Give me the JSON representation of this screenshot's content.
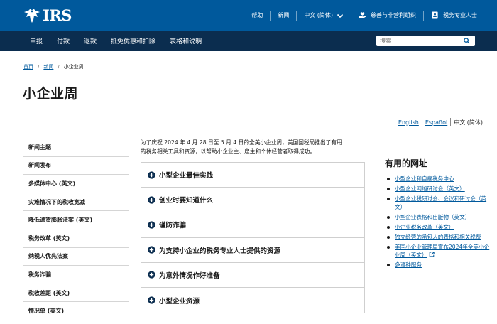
{
  "header": {
    "logo_text": "IRS",
    "links": {
      "help": "帮助",
      "news": "新闻",
      "language": "中文 (简体)",
      "charities": "慈善与非营利组织",
      "tax_pros": "税务专业人士"
    }
  },
  "nav": {
    "items": [
      "申报",
      "付款",
      "退款",
      "抵免优惠和扣除",
      "表格和说明"
    ],
    "search_placeholder": "搜索"
  },
  "breadcrumb": [
    "首页",
    "新闻",
    "小企业周"
  ],
  "page_title": "小企业周",
  "languages": {
    "english": "English",
    "spanish": "Español",
    "chinese": "中文 (简体)"
  },
  "sidebar": {
    "items": [
      "新闻主题",
      "新闻发布",
      "多媒体中心 (英文)",
      "灾难情况下的税收宽减",
      "降低通货膨胀法案 (英文)",
      "税务改革 (英文)",
      "纳税人优先法案",
      "税务诈骗",
      "税收差距 (英文)",
      "情况单 (英文)"
    ]
  },
  "main": {
    "intro_line1": "为了庆祝 2024 年 4 月 28 日至 5 月 4 日的全美小企业周，美国国税局推出了有用",
    "intro_line2": "的税务相关工具和资源，以帮助小企业主、雇主和个体经营者取得成功。",
    "accordion": [
      "小型企业最佳实践",
      "创业时要知道什么",
      "谨防诈骗",
      "为支持小企业的税务专业人士提供的资源",
      "为意外情况作好准备",
      "小型企业资源"
    ]
  },
  "useful_links": {
    "title": "有用的网址",
    "items": [
      "小型企业和自雇税务中心",
      "小型企业网络研讨会（英文）",
      "小型企业税研讨会、会议和研讨会（英文）",
      "小型企业表格和出版物（英文）",
      "小企业税务改革（英文）",
      "独立经营的承包人的表格和相关税费",
      "美国小企业管理局宣布2024年全美小企业周（英文）",
      "多语种服务"
    ]
  },
  "colors": {
    "brand_blue": "#00599c",
    "nav_dark": "#0b2d4f",
    "link": "#00599c"
  }
}
